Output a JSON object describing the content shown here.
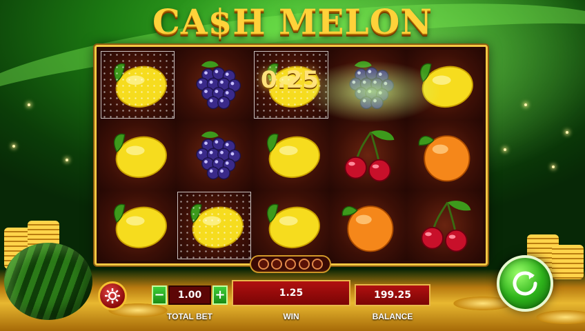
{
  "game": {
    "title": "CA$H MELON"
  },
  "reels": {
    "win_amount": "0.25",
    "grid": [
      [
        "lemon",
        "grapes",
        "lemon",
        "grapes",
        "lemon"
      ],
      [
        "lemon",
        "grapes",
        "lemon",
        "cherries",
        "orange"
      ],
      [
        "lemon",
        "lemon",
        "lemon",
        "orange",
        "cherries"
      ]
    ],
    "winning_cells": [
      [
        0,
        0
      ],
      [
        0,
        2
      ],
      [
        2,
        1
      ]
    ]
  },
  "controls": {
    "settings_icon": "gear-icon",
    "minus_label": "−",
    "plus_label": "+",
    "total_bet_value": "1.00",
    "total_bet_label": "TOTAL BET",
    "win_value": "1.25",
    "win_label": "WIN",
    "balance_value": "199.25",
    "balance_label": "BALANCE",
    "spin_icon": "spin-arrow-icon"
  },
  "progress": {
    "dots_total": 5,
    "dots_filled": 0
  },
  "colors": {
    "accent_gold": "#f5c842",
    "panel_red": "#b01010",
    "button_green": "#2fb41c"
  }
}
